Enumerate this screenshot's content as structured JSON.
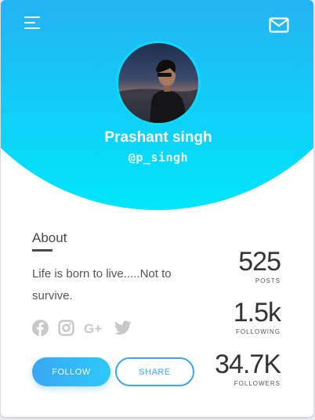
{
  "profile": {
    "name": "Prashant singh",
    "handle": "@p_singh"
  },
  "about": {
    "title": "About",
    "text": "Life is born to live.....Not to survive."
  },
  "social": [
    "facebook-icon",
    "instagram-icon",
    "google-plus-icon",
    "twitter-icon"
  ],
  "buttons": {
    "follow": "FOLLOW",
    "share": "SHARE"
  },
  "stats": [
    {
      "value": "525",
      "label": "POSTS"
    },
    {
      "value": "1.5k",
      "label": "FOLLOWING"
    },
    {
      "value": "34.7K",
      "label": "FOLLOWERS"
    }
  ],
  "colors": {
    "gradient_top": "#3d8df5",
    "gradient_bottom": "#00e6fb",
    "accent": "#3aa6f5"
  }
}
